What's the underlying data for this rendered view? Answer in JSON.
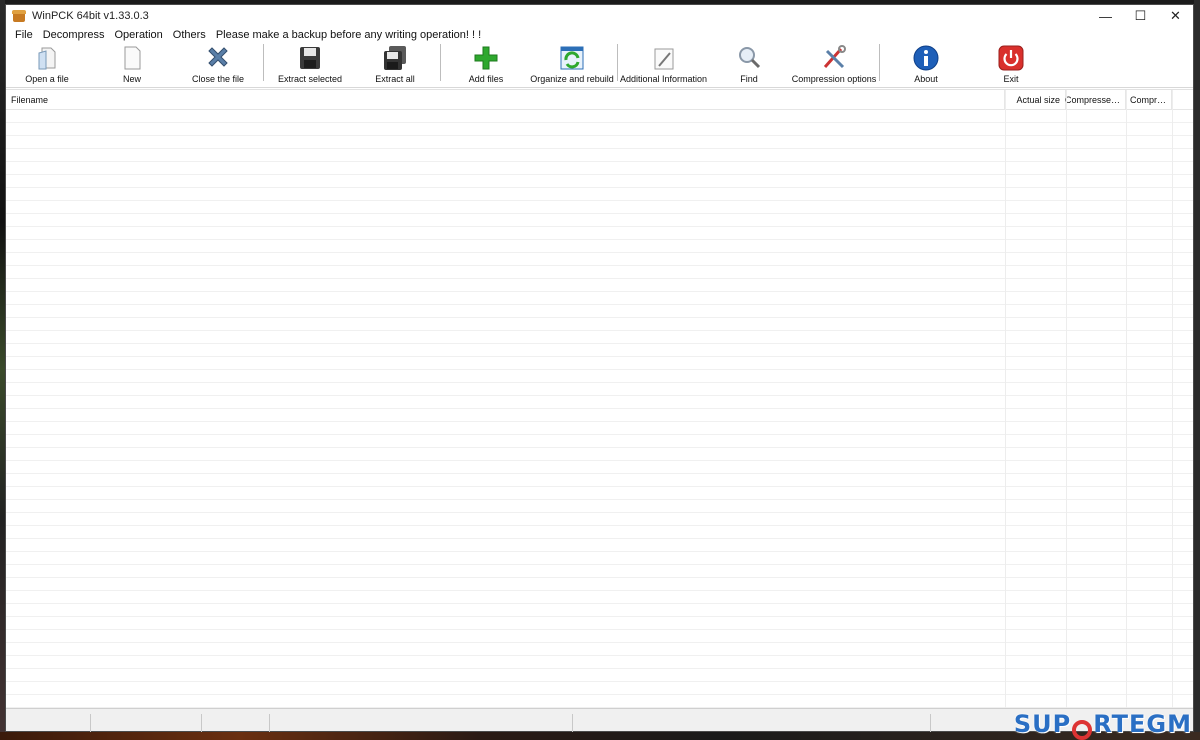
{
  "window": {
    "title": "WinPCK 64bit v1.33.0.3",
    "controls": {
      "minimize": "—",
      "maximize": "☐",
      "close": "✕"
    }
  },
  "menu": {
    "items": [
      "File",
      "Decompress",
      "Operation",
      "Others"
    ],
    "note": "Please make a backup before any writing operation! ! !"
  },
  "toolbar": {
    "buttons": [
      {
        "label": "Open a file",
        "icon": "open-file-icon"
      },
      {
        "label": "New",
        "icon": "new-file-icon"
      },
      {
        "label": "Close the file",
        "icon": "close-file-icon"
      },
      {
        "label": "Extract selected",
        "icon": "floppy-disk-icon"
      },
      {
        "label": "Extract all",
        "icon": "floppy-disks-icon"
      },
      {
        "label": "Add files",
        "icon": "green-plus-icon"
      },
      {
        "label": "Organize and rebuild",
        "icon": "rebuild-icon"
      },
      {
        "label": "Additional Information",
        "icon": "pencil-note-icon"
      },
      {
        "label": "Find",
        "icon": "magnifier-icon"
      },
      {
        "label": "Compression options",
        "icon": "tools-icon"
      },
      {
        "label": "About",
        "icon": "info-icon"
      },
      {
        "label": "Exit",
        "icon": "power-icon"
      }
    ]
  },
  "list": {
    "columns": [
      "Filename",
      "Actual size",
      "Compresse…",
      "Compr…"
    ]
  },
  "watermark": {
    "left": "SUP",
    "right": "RTEGM"
  },
  "colors": {
    "accent_blue": "#2a6fc4",
    "accent_red": "#d33333",
    "add_green": "#2ea82e",
    "exit_red": "#d9302c"
  }
}
